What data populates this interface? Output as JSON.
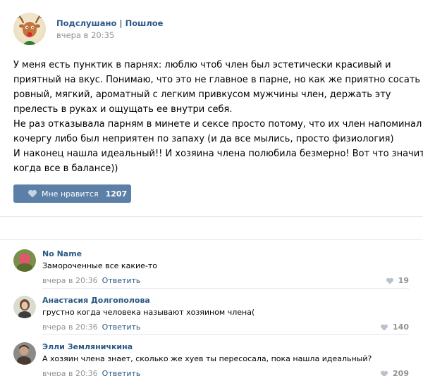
{
  "post": {
    "author": "Подслушано | Пошлое",
    "time": "вчера в 20:35",
    "lines": [
      "У меня есть пунктик в парнях: люблю чтоб член был эстетически красивый и",
      "приятный на вкус. Понимаю, что это не главное в парне, но как же приятно сосать",
      "ровный, мягкий, ароматный с легким привкусом мужчины член, держать эту",
      "прелесть в руках и ощущать ее внутри себя.",
      "Не раз отказывала парням в минете и сексе просто потому, что их член напоминал",
      "кочергу либо был неприятен по запаху (и да все мылись, просто физиология)",
      "И наконец нашла идеальный!! И хозяина члена полюбила безмерно! Вот что значит,",
      "когда все в балансе))"
    ],
    "like_label": "Мне нравится",
    "like_count": "1207"
  },
  "comments": [
    {
      "author": "No Name",
      "text": "Замороченные все какие-то",
      "time": "вчера в 20:36",
      "reply": "Ответить",
      "likes": "19"
    },
    {
      "author": "Анастасия Долгополова",
      "text": "грустно когда человека называют хозяином члена(",
      "time": "вчера в 20:36",
      "reply": "Ответить",
      "likes": "140"
    },
    {
      "author": "Элли Земляничкина",
      "text": "А хозяин члена знает, сколько же хуев ты пересосала, пока нашла идеальный?",
      "time": "вчера в 20:36",
      "reply": "Ответить",
      "likes": "209"
    }
  ],
  "colors": {
    "link": "#2a5885",
    "meta": "#939393",
    "like_button": "#5b7fa6",
    "divider": "#e7e8ec"
  }
}
